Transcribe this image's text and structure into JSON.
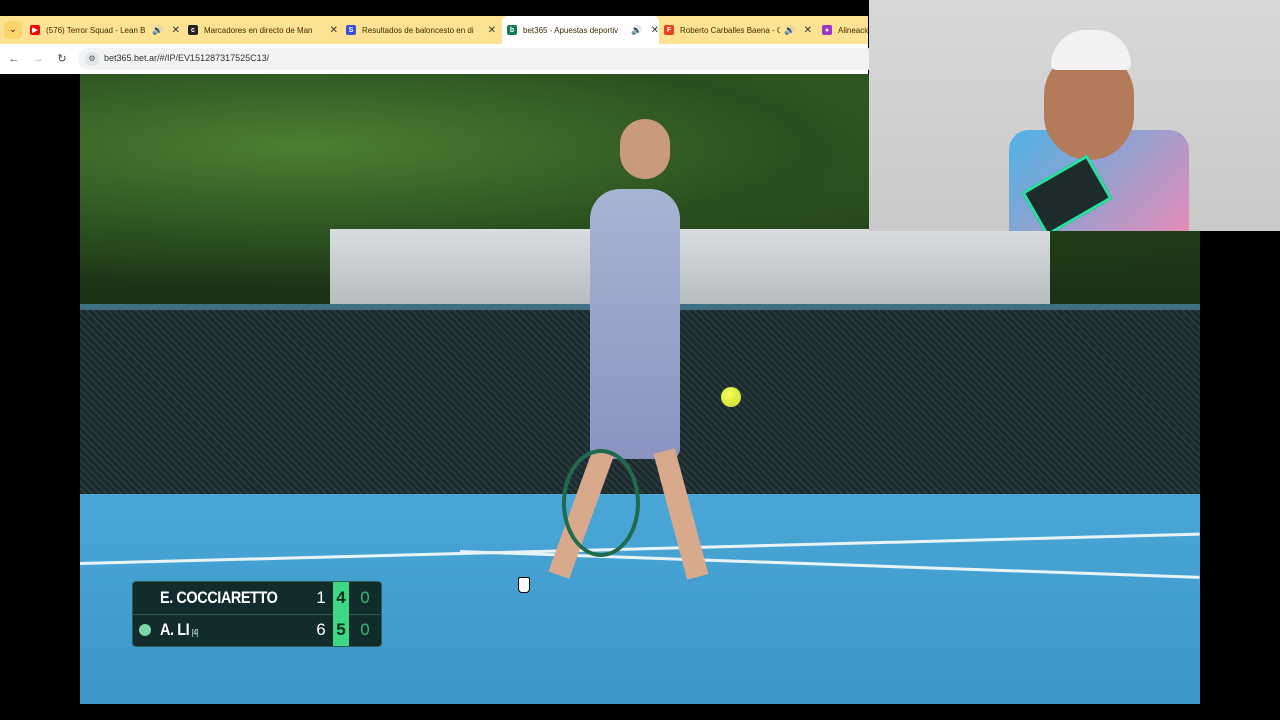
{
  "browser": {
    "tabs": [
      {
        "title": "(576) Terror Squad - Lean B",
        "favicon": "youtube-icon",
        "audio": true,
        "active": false
      },
      {
        "title": "Marcadores en directo de Man",
        "favicon": "flashscore-icon",
        "audio": false,
        "active": false
      },
      {
        "title": "Resultados de baloncesto en di",
        "favicon": "sofascore-icon",
        "audio": false,
        "active": false
      },
      {
        "title": "bet365 - Apuestas deportiv",
        "favicon": "bet365-icon",
        "audio": true,
        "active": true
      },
      {
        "title": "Roberto Carballes Baena - C",
        "favicon": "flashscore-icon",
        "audio": true,
        "active": false
      },
      {
        "title": "Alineacio",
        "favicon": "app-icon",
        "audio": false,
        "active": false
      }
    ],
    "url": "bet365.bet.ar/#/IP/EV151287317525C13/"
  },
  "scoreboard": {
    "players": [
      {
        "name": "E. COCCIARETTO",
        "seed": "",
        "sets": "1",
        "games": "4",
        "points": "0",
        "serving": false
      },
      {
        "name": "A. LI",
        "seed": "[4]",
        "sets": "6",
        "games": "5",
        "points": "0",
        "serving": true
      }
    ]
  },
  "colors": {
    "tab_strip": "#fde293",
    "score_highlight": "#3ed884",
    "court": "#4aa7d7"
  }
}
